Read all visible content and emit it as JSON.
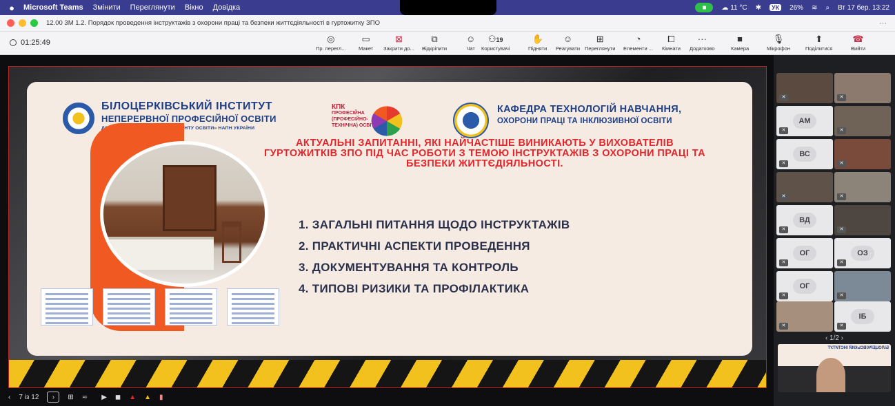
{
  "menubar": {
    "app_name": "Microsoft Teams",
    "items": [
      "Змінити",
      "Переглянути",
      "Вікно",
      "Довідка"
    ],
    "weather": "11 °C",
    "battery": "26%",
    "lang": "УК",
    "datetime": "Вт 17 бер. 13:22"
  },
  "window": {
    "title": "12.00 3М 1.2. Порядок проведення інструктажів з охорони праці та безпеки життєдіяльності в гуртожитку ЗПО",
    "more": "···"
  },
  "toolbar": {
    "timer": "01:25:49",
    "people_count": "19",
    "buttons": [
      {
        "label": "Пр. перегл...",
        "icon": "◎"
      },
      {
        "label": "Макет",
        "icon": "▭"
      },
      {
        "label": "Закрити до...",
        "icon": "⊠"
      },
      {
        "label": "Відкріпити",
        "icon": "⧉"
      },
      {
        "label": "Чат",
        "icon": "☺"
      },
      {
        "label": "Користувачі",
        "icon": "⚇"
      },
      {
        "label": "Підняти",
        "icon": "✋"
      },
      {
        "label": "Реагувати",
        "icon": "☺"
      },
      {
        "label": "Переглянути",
        "icon": "⊞"
      },
      {
        "label": "Елементи ...",
        "icon": "◔"
      },
      {
        "label": "Кімнати",
        "icon": "⧠"
      },
      {
        "label": "Додатково",
        "icon": "···"
      },
      {
        "label": "Камера",
        "icon": "■"
      },
      {
        "label": "Мікрофон",
        "icon": "🎙"
      },
      {
        "label": "Поділитися",
        "icon": "⬆"
      },
      {
        "label": "Вийти",
        "icon": "☎"
      }
    ]
  },
  "slide": {
    "institute_line1": "БІЛОЦЕРКІВСЬКИЙ ІНСТИТУТ",
    "institute_line2": "НЕПЕРЕРВНОЇ ПРОФЕСІЙНОЇ ОСВІТИ",
    "institute_line3": "ДЗВО «УНІВЕРСИТЕТ МЕНЕДЖМЕНТУ ОСВІТИ» НАПН УКРАЇНИ",
    "kpk_title": "КПК",
    "kpk_lines": [
      "ПРОФЕСІЙНА",
      "(ПРОФЕСІЙНО-",
      "ТЕХНІЧНА) ОСВІТА"
    ],
    "department_line1": "КАФЕДРА ТЕХНОЛОГІЙ НАВЧАННЯ,",
    "department_line2": "ОХОРОНИ ПРАЦІ ТА ІНКЛЮЗИВНОЇ ОСВІТИ",
    "headline": "АКТУАЛЬНІ ЗАПИТАННІ, ЯКІ НАЙЧАСТІШЕ ВИНИКАЮТЬ У ВИХОВАТЕЛІВ ГУРТОЖИТКІВ ЗПО ПІД ЧАС РОБОТИ З ТЕМОЮ ІНСТРУКТАЖІВ З ОХОРОНИ ПРАЦІ ТА БЕЗПЕКИ ЖИТТЄДІЯЛЬНОСТІ.",
    "items": [
      "1. ЗАГАЛЬНІ ПИТАННЯ ЩОДО ІНСТРУКТАЖІВ",
      "2. ПРАКТИЧНІ АСПЕКТИ ПРОВЕДЕННЯ",
      "3. ДОКУМЕНТУВАННЯ ТА КОНТРОЛЬ",
      "4. ТИПОВІ РИЗИКИ ТА ПРОФІЛАКТИКА"
    ]
  },
  "slide_nav": {
    "prev": "‹",
    "page": "7 із 12",
    "next": "›",
    "grid": "⊞",
    "settings": "≂"
  },
  "gallery": {
    "pager": "‹  1/2  ›",
    "avatars": [
      "АМ",
      "ВС",
      "ВД",
      "ОГ",
      "ОЗ",
      "ОГ",
      "ІБ"
    ]
  },
  "colors": {
    "menubar": "#3a3c8f",
    "accent_orange": "#f05a22",
    "headline_red": "#e3262b",
    "brand_blue": "#1f3f86"
  }
}
